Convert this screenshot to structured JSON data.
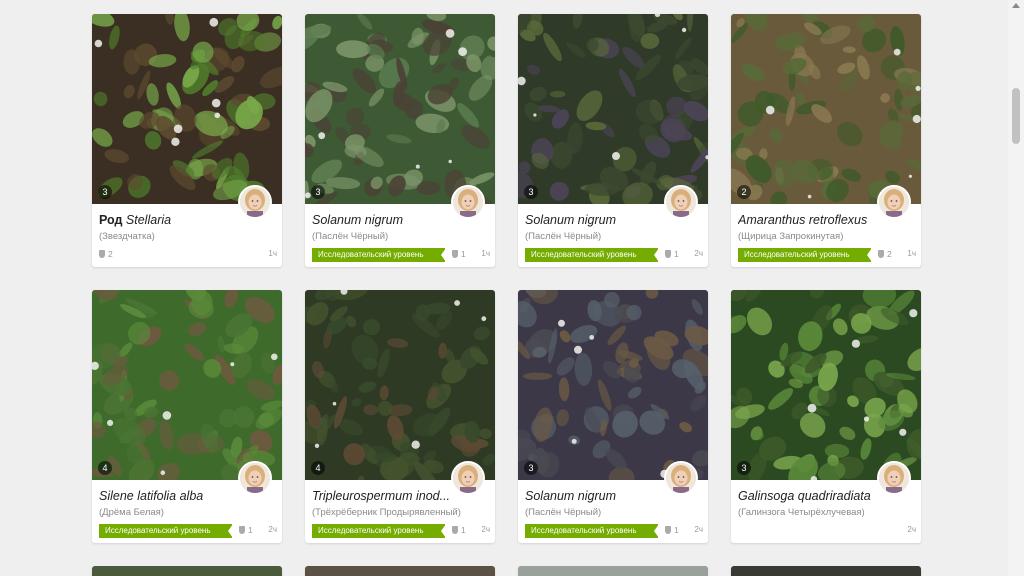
{
  "colors": {
    "badge_green": "#74ac00",
    "page_bg": "#efefef"
  },
  "observations": [
    {
      "rank": "Род",
      "name": "Stellaria",
      "common": "(Звездчатка)",
      "photos": "3",
      "badge": "",
      "ids": "2",
      "time": "1ч",
      "photo_colors": [
        "#3a2f22",
        "#4f7a2c",
        "#78a84a",
        "#5d4a30"
      ]
    },
    {
      "rank": "",
      "name": "Solanum nigrum",
      "common": "(Паслён Чёрный)",
      "photos": "3",
      "badge": "Исследовательский уровень",
      "ids": "1",
      "time": "1ч",
      "photo_colors": [
        "#3d5a34",
        "#5e7e52",
        "#7c9468",
        "#4b4236"
      ]
    },
    {
      "rank": "",
      "name": "Solanum nigrum",
      "common": "(Паслён Чёрный)",
      "photos": "3",
      "badge": "Исследовательский уровень",
      "ids": "1",
      "time": "2ч",
      "photo_colors": [
        "#2f3a28",
        "#4d4458",
        "#5a6a3a",
        "#3c4a30"
      ]
    },
    {
      "rank": "",
      "name": "Amaranthus retroflexus",
      "common": "(Щирица Запрокинутая)",
      "photos": "2",
      "badge": "Исследовательский уровень",
      "ids": "2",
      "time": "1ч",
      "photo_colors": [
        "#6a5a3c",
        "#586a38",
        "#8a7a52",
        "#3f5a2a"
      ]
    },
    {
      "rank": "",
      "name": "Silene latifolia alba",
      "common": "(Дрёма Белая)",
      "photos": "4",
      "badge": "Исследовательский уровень",
      "ids": "1",
      "time": "2ч",
      "photo_colors": [
        "#3e6a2c",
        "#5a8a3a",
        "#6e5a40",
        "#4b7434"
      ]
    },
    {
      "rank": "",
      "name": "Tripleurospermum inod...",
      "common": "(Трёхрёберник Продырявленный)",
      "photos": "4",
      "badge": "Исследовательский уровень",
      "ids": "1",
      "time": "2ч",
      "photo_colors": [
        "#2e3a24",
        "#44532e",
        "#5c4a34",
        "#384a2c"
      ]
    },
    {
      "rank": "",
      "name": "Solanum nigrum",
      "common": "(Паслён Чёрный)",
      "photos": "3",
      "badge": "Исследовательский уровень",
      "ids": "1",
      "time": "2ч",
      "photo_colors": [
        "#3c3848",
        "#56606a",
        "#6b5a44",
        "#4a4a52"
      ]
    },
    {
      "rank": "",
      "name": "Galinsoga quadriradiata",
      "common": "(Галинзога Четырёхлучевая)",
      "photos": "3",
      "badge": "",
      "ids": "",
      "time": "2ч",
      "photo_colors": [
        "#2c4a22",
        "#5a8a3a",
        "#7aa64c",
        "#3e5a2a"
      ]
    }
  ]
}
